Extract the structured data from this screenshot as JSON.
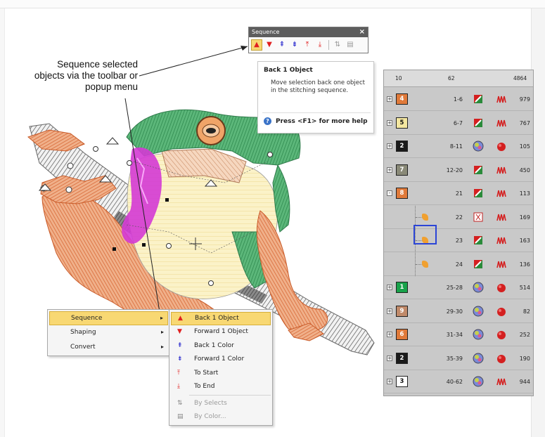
{
  "callout": {
    "text": "Sequence selected objects via the toolbar or popup menu"
  },
  "colors": {
    "highlight": "#f8d873",
    "frog_green": "#3e9a5e",
    "frog_magenta": "#d43ad4",
    "frog_orange": "#e38f60",
    "selection_blue": "#2b45d6"
  },
  "toolbar": {
    "title": "Sequence",
    "close_glyph": "×",
    "buttons": [
      {
        "icon": "back-1-object-icon",
        "glyph": "▲",
        "color": "#e02020"
      },
      {
        "icon": "forward-1-object-icon",
        "glyph": "▼",
        "color": "#e02020"
      },
      {
        "icon": "back-1-color-icon",
        "glyph": "⇞",
        "color": "#2222cc"
      },
      {
        "icon": "forward-1-color-icon",
        "glyph": "⇟",
        "color": "#2222cc"
      },
      {
        "icon": "to-start-icon",
        "glyph": "⤒",
        "color": "#e02020"
      },
      {
        "icon": "to-end-icon",
        "glyph": "⤓",
        "color": "#e02020"
      },
      {
        "icon": "by-selects-icon",
        "glyph": "⇅",
        "color": "#999999"
      },
      {
        "icon": "by-color-icon",
        "glyph": "▤",
        "color": "#999999"
      }
    ]
  },
  "tooltip": {
    "title": "Back 1 Object",
    "body": "Move selection back one object in the stitching sequence.",
    "help": "Press <F1> for more help"
  },
  "context_menu": {
    "items": [
      {
        "label": "Sequence",
        "arrow": "▸"
      },
      {
        "label": "Shaping",
        "arrow": "▸"
      },
      {
        "label": "Convert",
        "arrow": "▸"
      }
    ]
  },
  "submenu": {
    "items": [
      {
        "label": "Back 1 Object",
        "icon": "back-1-object-icon",
        "glyph": "▲",
        "color": "#e02020"
      },
      {
        "label": "Forward 1 Object",
        "icon": "forward-1-object-icon",
        "glyph": "▼",
        "color": "#e02020"
      },
      {
        "label": "Back 1 Color",
        "icon": "back-1-color-icon",
        "glyph": "⇞",
        "color": "#2222cc"
      },
      {
        "label": "Forward 1 Color",
        "icon": "forward-1-color-icon",
        "glyph": "⇟",
        "color": "#2222cc"
      },
      {
        "label": "To Start",
        "icon": "to-start-icon",
        "glyph": "⤒",
        "color": "#e02020"
      },
      {
        "label": "To End",
        "icon": "to-end-icon",
        "glyph": "⤓",
        "color": "#e02020"
      },
      {
        "label": "By Selects",
        "icon": "by-selects-icon",
        "glyph": "⇅",
        "color": "#888888"
      },
      {
        "label": "By Color...",
        "icon": "by-color-icon",
        "glyph": "▤",
        "color": "#888888"
      }
    ]
  },
  "docker": {
    "header": {
      "colors": "10",
      "objects": "62",
      "stitches": "4864"
    },
    "rows": [
      {
        "swatch": "4",
        "color": "#e07a3a",
        "text": "#ffffff",
        "expander": "+",
        "range": "1-6",
        "obj_icon": "satin-icon",
        "stitch_icon": "stitch-red-icon",
        "count": "979"
      },
      {
        "swatch": "5",
        "color": "#f4e7a0",
        "text": "#111111",
        "expander": "+",
        "range": "6-7",
        "obj_icon": "satin-icon",
        "stitch_icon": "stitch-red-icon",
        "count": "767"
      },
      {
        "swatch": "2",
        "color": "#1a1a1a",
        "text": "#ffffff",
        "expander": "+",
        "range": "8-11",
        "obj_icon": "fill-icon",
        "stitch_icon": "ball-icon",
        "count": "105"
      },
      {
        "swatch": "7",
        "color": "#8a8a78",
        "text": "#ffffff",
        "expander": "+",
        "range": "12-20",
        "obj_icon": "satin-icon",
        "stitch_icon": "stitch-red-icon",
        "count": "450"
      },
      {
        "swatch": "8",
        "color": "#e07a3a",
        "text": "#ffffff",
        "expander": "-",
        "range": "21",
        "obj_icon": "satin-icon",
        "stitch_icon": "stitch-red-icon",
        "count": "113"
      },
      {
        "swatch": "",
        "color": "",
        "text": "",
        "expander": "",
        "range": "22",
        "obj_icon": "satin-outline-icon",
        "stitch_icon": "stitch-red-icon",
        "count": "169"
      },
      {
        "swatch": "",
        "color": "",
        "text": "",
        "expander": "",
        "range": "23",
        "obj_icon": "satin-icon",
        "stitch_icon": "stitch-red-icon",
        "count": "163"
      },
      {
        "swatch": "",
        "color": "",
        "text": "",
        "expander": "",
        "range": "24",
        "obj_icon": "satin-icon",
        "stitch_icon": "stitch-red-icon",
        "count": "136"
      },
      {
        "swatch": "1",
        "color": "#18a24a",
        "text": "#ffffff",
        "expander": "+",
        "range": "25-28",
        "obj_icon": "fill-icon",
        "stitch_icon": "ball-icon",
        "count": "514"
      },
      {
        "swatch": "9",
        "color": "#c08a6a",
        "text": "#ffffff",
        "expander": "+",
        "range": "29-30",
        "obj_icon": "fill-icon",
        "stitch_icon": "ball-icon",
        "count": "82"
      },
      {
        "swatch": "6",
        "color": "#e07a3a",
        "text": "#ffffff",
        "expander": "+",
        "range": "31-34",
        "obj_icon": "fill-icon",
        "stitch_icon": "ball-icon",
        "count": "252"
      },
      {
        "swatch": "2",
        "color": "#1a1a1a",
        "text": "#ffffff",
        "expander": "+",
        "range": "35-39",
        "obj_icon": "fill-icon",
        "stitch_icon": "ball-icon",
        "count": "190"
      },
      {
        "swatch": "3",
        "color": "#ffffff",
        "text": "#111111",
        "expander": "+",
        "range": "40-62",
        "obj_icon": "fill-icon",
        "stitch_icon": "stitch-red-icon",
        "count": "944"
      }
    ]
  }
}
